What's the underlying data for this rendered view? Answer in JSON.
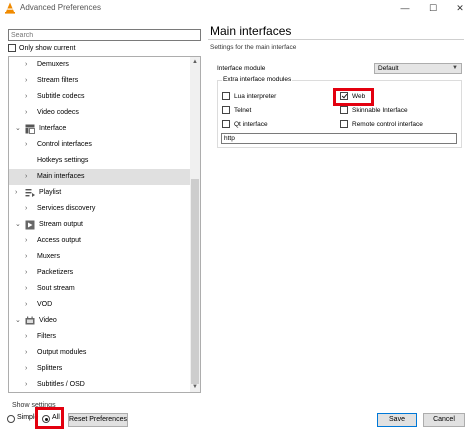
{
  "window": {
    "title": "Advanced Preferences",
    "minimize_glyph": "—",
    "maximize_glyph": "☐",
    "close_glyph": "✕"
  },
  "left": {
    "search_placeholder": "Search",
    "only_show_current": "Only show current",
    "tree": [
      {
        "label": "Demuxers",
        "level": 1,
        "expander": "›",
        "icon": null,
        "selected": false
      },
      {
        "label": "Stream filters",
        "level": 1,
        "expander": "›",
        "icon": null,
        "selected": false
      },
      {
        "label": "Subtitle codecs",
        "level": 1,
        "expander": "›",
        "icon": null,
        "selected": false
      },
      {
        "label": "Video codecs",
        "level": 1,
        "expander": "›",
        "icon": null,
        "selected": false
      },
      {
        "label": "Interface",
        "level": 0,
        "expander": "⌄",
        "icon": "interface-icon",
        "selected": false
      },
      {
        "label": "Control interfaces",
        "level": 1,
        "expander": "›",
        "icon": null,
        "selected": false
      },
      {
        "label": "Hotkeys settings",
        "level": 1,
        "expander": "",
        "icon": null,
        "selected": false
      },
      {
        "label": "Main interfaces",
        "level": 1,
        "expander": "›",
        "icon": null,
        "selected": true
      },
      {
        "label": "Playlist",
        "level": 0,
        "expander": "›",
        "icon": "playlist-icon",
        "selected": false
      },
      {
        "label": "Services discovery",
        "level": 1,
        "expander": "›",
        "icon": null,
        "selected": false
      },
      {
        "label": "Stream output",
        "level": 0,
        "expander": "⌄",
        "icon": "stream-output-icon",
        "selected": false
      },
      {
        "label": "Access output",
        "level": 1,
        "expander": "›",
        "icon": null,
        "selected": false
      },
      {
        "label": "Muxers",
        "level": 1,
        "expander": "›",
        "icon": null,
        "selected": false
      },
      {
        "label": "Packetizers",
        "level": 1,
        "expander": "›",
        "icon": null,
        "selected": false
      },
      {
        "label": "Sout stream",
        "level": 1,
        "expander": "›",
        "icon": null,
        "selected": false
      },
      {
        "label": "VOD",
        "level": 1,
        "expander": "›",
        "icon": null,
        "selected": false
      },
      {
        "label": "Video",
        "level": 0,
        "expander": "⌄",
        "icon": "video-icon",
        "selected": false
      },
      {
        "label": "Filters",
        "level": 1,
        "expander": "›",
        "icon": null,
        "selected": false
      },
      {
        "label": "Output modules",
        "level": 1,
        "expander": "›",
        "icon": null,
        "selected": false
      },
      {
        "label": "Splitters",
        "level": 1,
        "expander": "›",
        "icon": null,
        "selected": false
      },
      {
        "label": "Subtitles / OSD",
        "level": 1,
        "expander": "›",
        "icon": null,
        "selected": false
      }
    ],
    "show_settings_label": "Show settings",
    "simple_label": "Simple",
    "all_label": "All",
    "reset_label": "Reset Preferences"
  },
  "right": {
    "title": "Main interfaces",
    "subtitle": "Settings for the main interface",
    "interface_module_label": "Interface module",
    "interface_module_value": "Default",
    "extra_modules_title": "Extra interface modules",
    "options": {
      "lua": {
        "label": "Lua interpreter",
        "checked": false
      },
      "web": {
        "label": "Web",
        "checked": true
      },
      "telnet": {
        "label": "Telnet",
        "checked": false
      },
      "skinnable": {
        "label": "Skinnable Interface",
        "checked": false
      },
      "qt": {
        "label": "Qt interface",
        "checked": false
      },
      "remote": {
        "label": "Remote control interface",
        "checked": false
      }
    },
    "modules_text": "http"
  },
  "footer": {
    "save_label": "Save",
    "cancel_label": "Cancel"
  },
  "colors": {
    "highlight": "#e3000f",
    "selected_row": "#e0e0e0"
  }
}
